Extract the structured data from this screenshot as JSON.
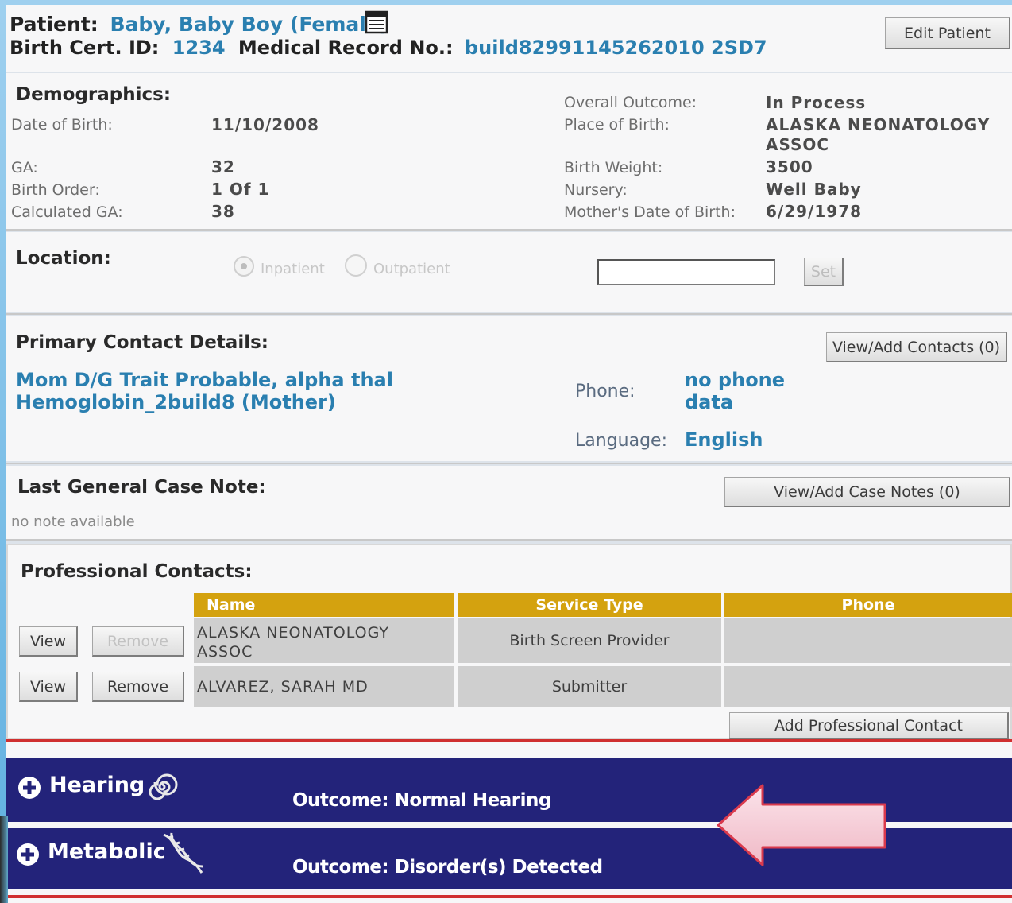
{
  "header": {
    "patient_label": "Patient:",
    "patient_name": "Baby, Baby Boy (Female)",
    "birth_cert_label": "Birth Cert. ID:",
    "birth_cert_id": "1234",
    "mrn_label": "Medical Record No.:",
    "mrn": "build82991145262010 2SD7",
    "edit_button": "Edit Patient"
  },
  "demographics": {
    "title": "Demographics:",
    "left": [
      {
        "label": "Date of Birth:",
        "value": "11/10/2008"
      },
      {
        "label": "GA:",
        "value": "32"
      },
      {
        "label": "Birth Order:",
        "value": "1 Of 1"
      },
      {
        "label": "Calculated GA:",
        "value": "38"
      }
    ],
    "right": [
      {
        "label": "Overall Outcome:",
        "value": "In Process"
      },
      {
        "label": "Place of Birth:",
        "value": "ALASKA NEONATOLOGY ASSOC"
      },
      {
        "label": "Birth Weight:",
        "value": "3500"
      },
      {
        "label": "Nursery:",
        "value": "Well Baby"
      },
      {
        "label": "Mother's Date of Birth:",
        "value": "6/29/1978"
      }
    ]
  },
  "location": {
    "title": "Location:",
    "inpatient_label": "Inpatient",
    "outpatient_label": "Outpatient",
    "input_value": "",
    "set_button": "Set"
  },
  "primary_contact": {
    "title": "Primary Contact Details:",
    "button": "View/Add Contacts (0)",
    "name_line1": "Mom D/G Trait Probable, alpha thal",
    "name_line2": "Hemoglobin_2build8 (Mother)",
    "phone_label": "Phone:",
    "phone_line1": "no phone",
    "phone_line2": "data",
    "language_label": "Language:",
    "language": "English"
  },
  "case_note": {
    "title": "Last General Case Note:",
    "button": "View/Add Case Notes (0)",
    "note": "no note available"
  },
  "professional_contacts": {
    "title": "Professional Contacts:",
    "columns": [
      "Name",
      "Service Type",
      "Phone"
    ],
    "rows": [
      {
        "name_line1": "ALASKA NEONATOLOGY",
        "name_line2": "ASSOC",
        "service": "Birth Screen Provider",
        "phone": "",
        "view": "View",
        "remove": "Remove"
      },
      {
        "name_line1": "ALVAREZ, SARAH MD",
        "name_line2": "",
        "service": "Submitter",
        "phone": "",
        "view": "View",
        "remove": "Remove"
      }
    ],
    "add_button": "Add Professional Contact"
  },
  "sections": [
    {
      "title": "Hearing",
      "outcome": "Outcome: Normal Hearing",
      "icon": "ear-spiral-icon"
    },
    {
      "title": "Metabolic",
      "outcome": "Outcome: Disorder(s) Detected",
      "icon": "dna-icon"
    }
  ],
  "colors": {
    "link": "#2a7fb0",
    "table_header": "#d4a20f",
    "section_band": "#23237a",
    "highlight_arrow": "#f4c3cf",
    "separator_red": "#d03030"
  }
}
